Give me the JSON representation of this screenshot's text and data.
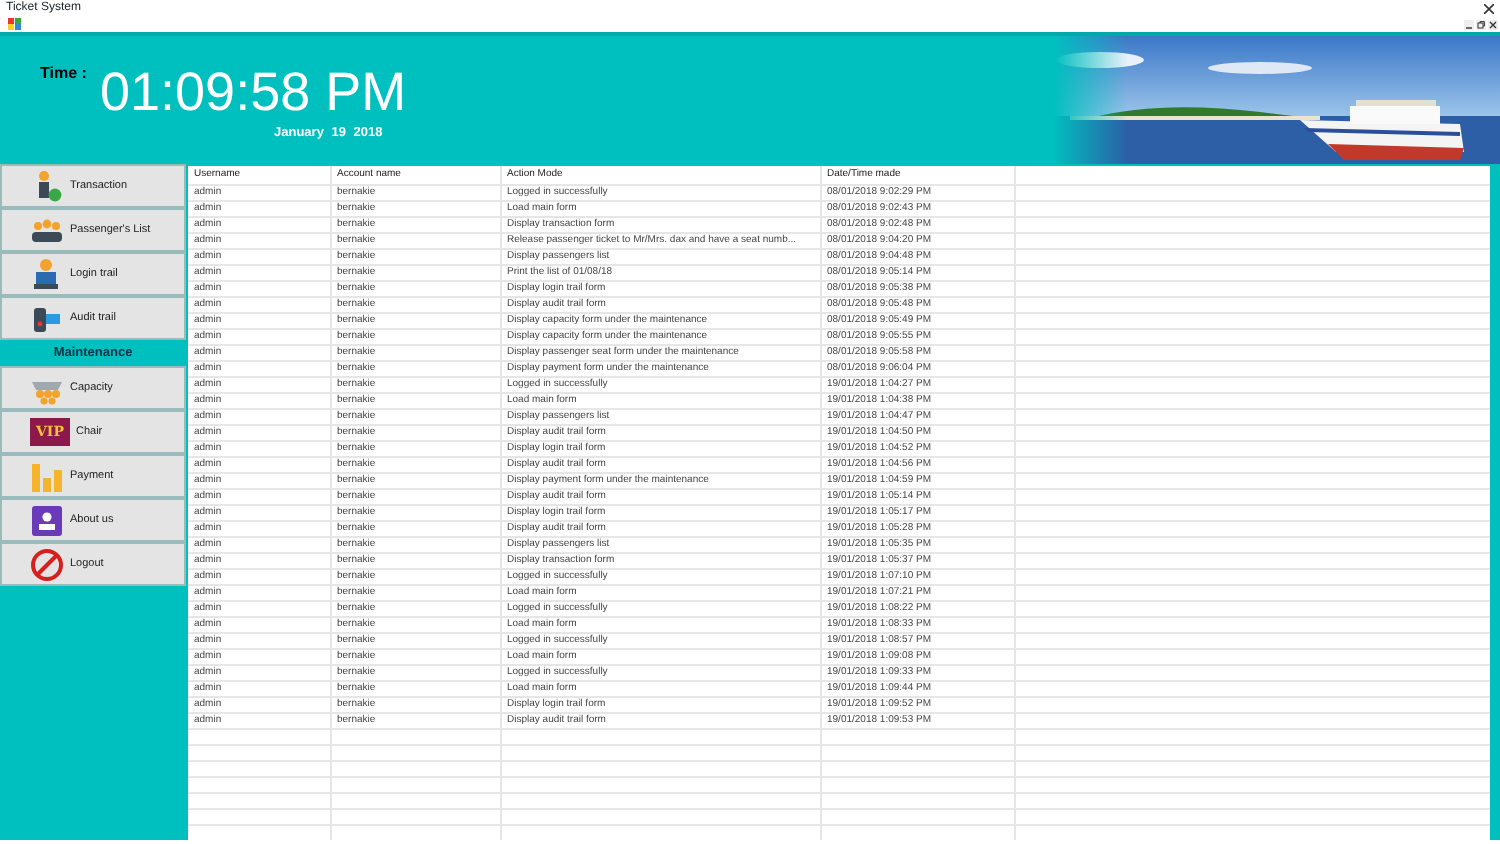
{
  "window": {
    "title": "Ticket System"
  },
  "header": {
    "clock_label": "Time :",
    "time": "01:09:58 PM",
    "date": "January 19 2018"
  },
  "menu": [
    {
      "kind": "button",
      "label": "Transaction"
    },
    {
      "kind": "button",
      "label": "Passenger's List"
    },
    {
      "kind": "button",
      "label": "Login trail"
    },
    {
      "kind": "button",
      "label": "Audit trail"
    },
    {
      "kind": "section",
      "label": "Maintenance"
    },
    {
      "kind": "button",
      "label": "Capacity"
    },
    {
      "kind": "button",
      "label": "Chair",
      "badge": "VIP"
    },
    {
      "kind": "button",
      "label": "Payment"
    },
    {
      "kind": "button",
      "label": "About us"
    },
    {
      "kind": "button",
      "label": "Logout"
    }
  ],
  "table": {
    "columns": [
      "Username",
      "Account name",
      "Action Mode",
      "Date/Time made"
    ],
    "rows": [
      [
        "admin",
        "bernakie",
        "Logged in successfully",
        "08/01/2018 9:02:29 PM"
      ],
      [
        "admin",
        "bernakie",
        "Load main form",
        "08/01/2018 9:02:43 PM"
      ],
      [
        "admin",
        "bernakie",
        "Display transaction form",
        "08/01/2018 9:02:48 PM"
      ],
      [
        "admin",
        "bernakie",
        "Release passenger ticket to Mr/Mrs. dax and have a seat numb...",
        "08/01/2018 9:04:20 PM"
      ],
      [
        "admin",
        "bernakie",
        "Display passengers list",
        "08/01/2018 9:04:48 PM"
      ],
      [
        "admin",
        "bernakie",
        "Print the list of 01/08/18",
        "08/01/2018 9:05:14 PM"
      ],
      [
        "admin",
        "bernakie",
        "Display login trail form",
        "08/01/2018 9:05:38 PM"
      ],
      [
        "admin",
        "bernakie",
        "Display audit trail form",
        "08/01/2018 9:05:48 PM"
      ],
      [
        "admin",
        "bernakie",
        "Display capacity form under the maintenance",
        "08/01/2018 9:05:49 PM"
      ],
      [
        "admin",
        "bernakie",
        "Display capacity form under the maintenance",
        "08/01/2018 9:05:55 PM"
      ],
      [
        "admin",
        "bernakie",
        "Display passenger seat form under the maintenance",
        "08/01/2018 9:05:58 PM"
      ],
      [
        "admin",
        "bernakie",
        "Display payment form under the maintenance",
        "08/01/2018 9:06:04 PM"
      ],
      [
        "admin",
        "bernakie",
        "Logged in successfully",
        "19/01/2018 1:04:27 PM"
      ],
      [
        "admin",
        "bernakie",
        "Load main form",
        "19/01/2018 1:04:38 PM"
      ],
      [
        "admin",
        "bernakie",
        "Display passengers list",
        "19/01/2018 1:04:47 PM"
      ],
      [
        "admin",
        "bernakie",
        "Display audit trail form",
        "19/01/2018 1:04:50 PM"
      ],
      [
        "admin",
        "bernakie",
        "Display login trail form",
        "19/01/2018 1:04:52 PM"
      ],
      [
        "admin",
        "bernakie",
        "Display audit trail form",
        "19/01/2018 1:04:56 PM"
      ],
      [
        "admin",
        "bernakie",
        "Display payment form under the maintenance",
        "19/01/2018 1:04:59 PM"
      ],
      [
        "admin",
        "bernakie",
        "Display audit trail form",
        "19/01/2018 1:05:14 PM"
      ],
      [
        "admin",
        "bernakie",
        "Display login trail form",
        "19/01/2018 1:05:17 PM"
      ],
      [
        "admin",
        "bernakie",
        "Display audit trail form",
        "19/01/2018 1:05:28 PM"
      ],
      [
        "admin",
        "bernakie",
        "Display passengers list",
        "19/01/2018 1:05:35 PM"
      ],
      [
        "admin",
        "bernakie",
        "Display transaction form",
        "19/01/2018 1:05:37 PM"
      ],
      [
        "admin",
        "bernakie",
        "Logged in successfully",
        "19/01/2018 1:07:10 PM"
      ],
      [
        "admin",
        "bernakie",
        "Load main form",
        "19/01/2018 1:07:21 PM"
      ],
      [
        "admin",
        "bernakie",
        "Logged in successfully",
        "19/01/2018 1:08:22 PM"
      ],
      [
        "admin",
        "bernakie",
        "Load main form",
        "19/01/2018 1:08:33 PM"
      ],
      [
        "admin",
        "bernakie",
        "Logged in successfully",
        "19/01/2018 1:08:57 PM"
      ],
      [
        "admin",
        "bernakie",
        "Load main form",
        "19/01/2018 1:09:08 PM"
      ],
      [
        "admin",
        "bernakie",
        "Logged in successfully",
        "19/01/2018 1:09:33 PM"
      ],
      [
        "admin",
        "bernakie",
        "Load main form",
        "19/01/2018 1:09:44 PM"
      ],
      [
        "admin",
        "bernakie",
        "Display login trail form",
        "19/01/2018 1:09:52 PM"
      ],
      [
        "admin",
        "bernakie",
        "Display audit trail form",
        "19/01/2018 1:09:53 PM"
      ]
    ]
  }
}
